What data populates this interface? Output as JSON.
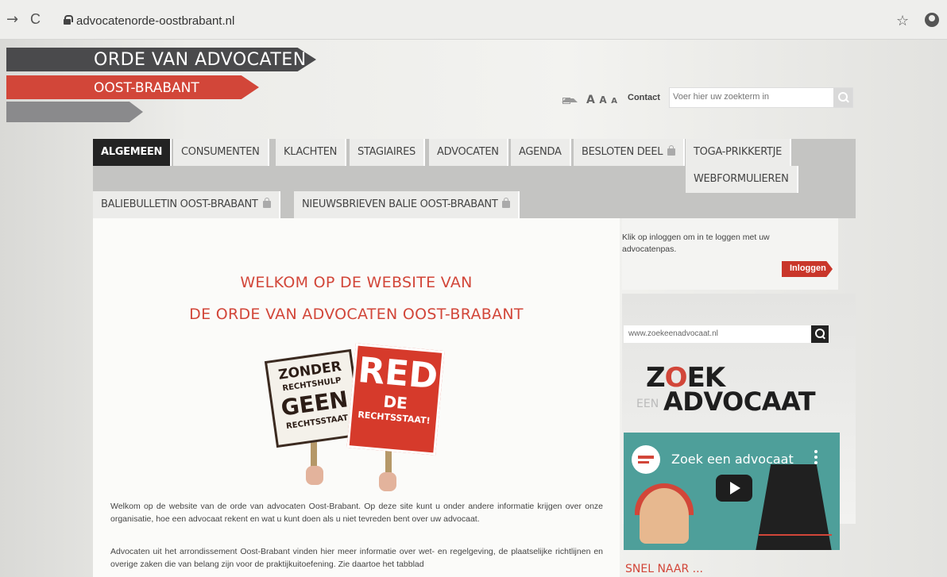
{
  "browser": {
    "url": "advocatenorde-oostbrabant.nl",
    "back_glyph": "→",
    "reload_glyph": "C",
    "bookmark_glyph": "☆"
  },
  "header": {
    "logo_line1": "ORDE VAN ADVOCATEN",
    "logo_line2": "OOST-BRABANT",
    "aaa": [
      "A",
      "A",
      "A"
    ],
    "contact": "Contact",
    "search_placeholder": "Voer hier uw zoekterm in"
  },
  "nav": {
    "tabs": [
      "ALGEMEEN",
      "CONSUMENTEN",
      "KLACHTEN",
      "STAGIAIRES",
      "ADVOCATEN",
      "AGENDA",
      "BESLOTEN DEEL",
      "TOGA-PRIKKERTJE",
      "WEBFORMULIEREN",
      "BALIEBULLETIN OOST-BRABANT",
      "NIEUWSBRIEVEN BALIE OOST-BRABANT"
    ],
    "active_index": 0
  },
  "main": {
    "headline1": "WELKOM OP DE WEBSITE VAN",
    "headline2": "DE ORDE VAN ADVOCATEN OOST-BRABANT",
    "sign_left": [
      "ZONDER",
      "RECHTSHULP",
      "GEEN",
      "RECHTSSTAAT"
    ],
    "sign_right": [
      "RED",
      "DE",
      "RECHTSSTAAT!"
    ],
    "paragraph1": "Welkom op de website van de orde van advocaten Oost-Brabant. Op deze site kunt u onder andere informatie krijgen over onze organisatie, hoe een advocaat rekent en wat u kunt doen als u niet tevreden bent over uw advocaat.",
    "paragraph2": "Advocaten uit het arrondissement Oost-Brabant vinden hier meer informatie over wet- en regelgeving, de plaatselijke richtlijnen en overige zaken die van belang zijn voor de praktijkuitoefening. Zie daartoe het tabblad"
  },
  "sidebar": {
    "login_text": "Klik op inloggen om in te loggen met uw advocatenpas.",
    "login_button": "Inloggen",
    "zoek_input": "www.zoekeenadvocaat.nl",
    "logo_zoek_pre": "Z",
    "logo_zoek_o": "O",
    "logo_zoek_post": "EK",
    "logo_een": "EEN",
    "logo_advocaat": "ADVOCAAT",
    "video_title": "Zoek een advocaat",
    "snel_naar": "SNEL NAAR ..."
  },
  "colors": {
    "brand_red": "#d24639",
    "brand_dark": "#4a4a4c",
    "nav_active": "#232323"
  }
}
